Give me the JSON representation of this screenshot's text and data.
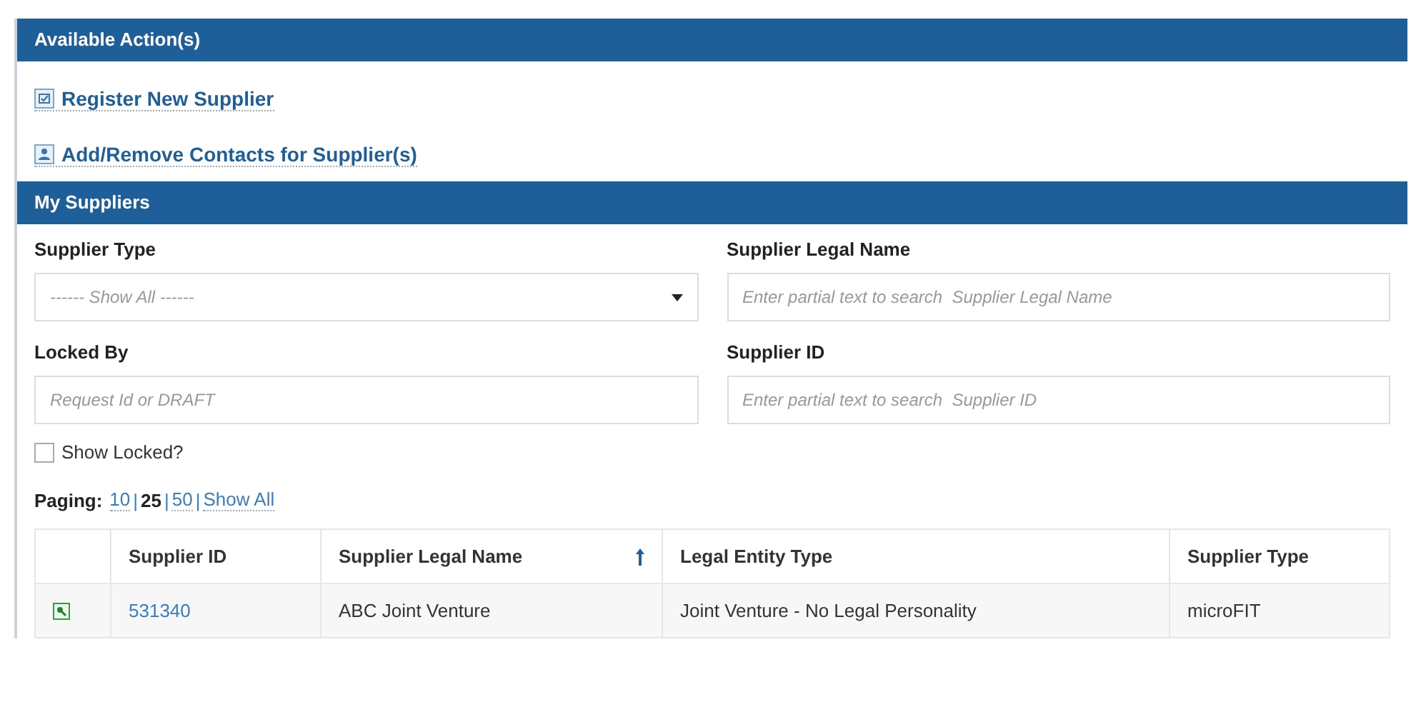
{
  "actions_panel": {
    "title": "Available Action(s)",
    "actions": [
      {
        "label": "Register New Supplier",
        "kind": "register"
      },
      {
        "label": "Add/Remove Contacts for Supplier(s)",
        "kind": "contacts"
      }
    ]
  },
  "suppliers_panel": {
    "title": "My Suppliers",
    "filters": [
      {
        "label": "Supplier Type",
        "kind": "select",
        "placeholder": "------ Show All ------"
      },
      {
        "label": "Supplier Legal Name",
        "kind": "text",
        "placeholder": "Enter partial text to search  Supplier Legal Name"
      },
      {
        "label": "Locked By",
        "kind": "text",
        "placeholder": "Request Id or DRAFT"
      },
      {
        "label": "Supplier ID",
        "kind": "text",
        "placeholder": "Enter partial text to search  Supplier ID"
      }
    ],
    "show_locked": {
      "label": "Show Locked?",
      "checked": false
    },
    "paging": {
      "label": "Paging:",
      "separator": "|",
      "options": [
        {
          "label": "10",
          "selected": false
        },
        {
          "label": "25",
          "selected": true
        },
        {
          "label": "50",
          "selected": false
        },
        {
          "label": "Show All",
          "selected": false
        }
      ]
    },
    "table": {
      "columns": [
        {
          "label": "Supplier ID",
          "sorted_ascending": false
        },
        {
          "label": "Supplier Legal Name",
          "sorted_ascending": true
        },
        {
          "label": "Legal Entity Type",
          "sorted_ascending": false
        },
        {
          "label": "Supplier Type",
          "sorted_ascending": false
        }
      ],
      "rows": [
        {
          "id": "531340",
          "legal_name": "ABC Joint Venture",
          "entity_type": "Joint Venture - No Legal Personality",
          "supplier_type": "microFIT"
        }
      ]
    }
  }
}
